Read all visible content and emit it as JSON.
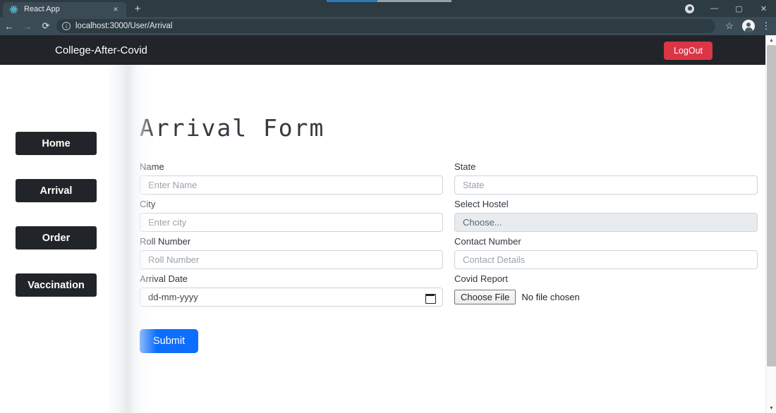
{
  "browser": {
    "tab": {
      "title": "React App",
      "favicon_icon": "react-logo-icon",
      "close_icon": "×"
    },
    "new_tab_icon": "+",
    "window_controls": {
      "record_icon": "record-dot-icon",
      "minimize": "—",
      "maximize": "▢",
      "close": "✕"
    },
    "toolbar": {
      "back_icon": "←",
      "forward_icon": "→",
      "reload_icon": "⟳",
      "site_info_icon": "ⓘ",
      "url": "localhost:3000/User/Arrival",
      "bookmark_icon": "☆",
      "profile_icon": "avatar-icon",
      "menu_icon": "⋮"
    }
  },
  "navbar": {
    "brand": "College-After-Covid",
    "logout_label": "LogOut",
    "bg_color": "#212529",
    "logout_color": "#dc3545"
  },
  "sidebar": {
    "items": [
      {
        "label": "Home"
      },
      {
        "label": "Arrival"
      },
      {
        "label": "Order"
      },
      {
        "label": "Vaccination"
      }
    ]
  },
  "main": {
    "title": "Arrival Form",
    "left_fields": [
      {
        "label": "Name",
        "type": "text",
        "placeholder": "Enter Name",
        "value": ""
      },
      {
        "label": "City",
        "type": "text",
        "placeholder": "Enter city",
        "value": ""
      },
      {
        "label": "Roll Number",
        "type": "text",
        "placeholder": "Roll Number",
        "value": ""
      },
      {
        "label": "Arrival Date",
        "type": "date",
        "placeholder": "dd-mm-yyyy",
        "value": "dd-mm-yyyy"
      }
    ],
    "right_fields": [
      {
        "label": "State",
        "type": "text",
        "placeholder": "State",
        "value": ""
      },
      {
        "label": "Select Hostel",
        "type": "select",
        "placeholder": "Choose...",
        "value": "Choose..."
      },
      {
        "label": "Contact Number",
        "type": "text",
        "placeholder": "Contact Details",
        "value": ""
      },
      {
        "label": "Covid Report",
        "type": "file",
        "button_label": "Choose File",
        "file_status": "No file chosen"
      }
    ],
    "submit_label": "Submit",
    "submit_color": "#0d6efd"
  },
  "scrollbar": {
    "up_icon": "▲",
    "down_icon": "▼"
  }
}
